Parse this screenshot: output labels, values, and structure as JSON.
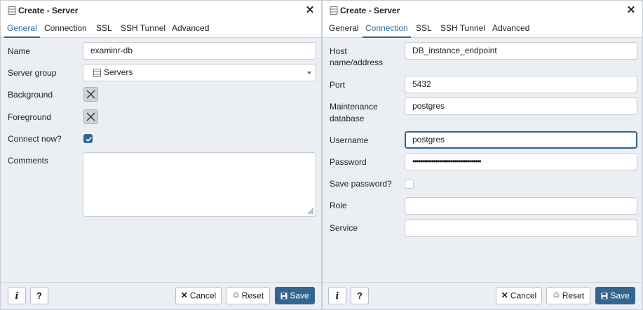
{
  "dialogs": [
    {
      "title": "Create - Server",
      "tabs": [
        {
          "label": "General"
        },
        {
          "label": "Connection"
        },
        {
          "label": "SSL"
        },
        {
          "label": "SSH Tunnel"
        },
        {
          "label": "Advanced"
        }
      ],
      "active_tab": "General",
      "fields": {
        "name": {
          "label": "Name",
          "value": "examinr-db"
        },
        "server_group": {
          "label": "Server group",
          "value": "Servers",
          "icon": "server-group-icon"
        },
        "background": {
          "label": "Background",
          "icon": "x-icon"
        },
        "foreground": {
          "label": "Foreground",
          "icon": "x-icon"
        },
        "connect_now": {
          "label": "Connect now?",
          "checked": true
        },
        "comments": {
          "label": "Comments",
          "value": ""
        }
      },
      "footer": {
        "info_icon": "info-icon",
        "help_label": "?",
        "cancel_label": "Cancel",
        "reset_label": "Reset",
        "save_label": "Save"
      }
    },
    {
      "title": "Create - Server",
      "tabs": [
        {
          "label": "General"
        },
        {
          "label": "Connection"
        },
        {
          "label": "SSL"
        },
        {
          "label": "SSH Tunnel"
        },
        {
          "label": "Advanced"
        }
      ],
      "active_tab": "Connection",
      "fields": {
        "host": {
          "label_line1": "Host",
          "label_line2": "name/address",
          "value": "DB_instance_endpoint"
        },
        "port": {
          "label": "Port",
          "value": "5432"
        },
        "maintenance_db": {
          "label_line1": "Maintenance",
          "label_line2": "database",
          "value": "postgres"
        },
        "username": {
          "label": "Username",
          "value": "postgres"
        },
        "password": {
          "label": "Password",
          "value": "••••••••••••••••••••••••••••••••••••"
        },
        "save_password": {
          "label": "Save password?",
          "checked": false
        },
        "role": {
          "label": "Role",
          "value": ""
        },
        "service": {
          "label": "Service",
          "value": ""
        }
      },
      "footer": {
        "info_icon": "info-icon",
        "help_label": "?",
        "cancel_label": "Cancel",
        "reset_label": "Reset",
        "save_label": "Save"
      }
    }
  ],
  "colors": {
    "accent": "#326690",
    "dialog_bg": "#ebeef3",
    "field_border": "#c8ccd2"
  }
}
